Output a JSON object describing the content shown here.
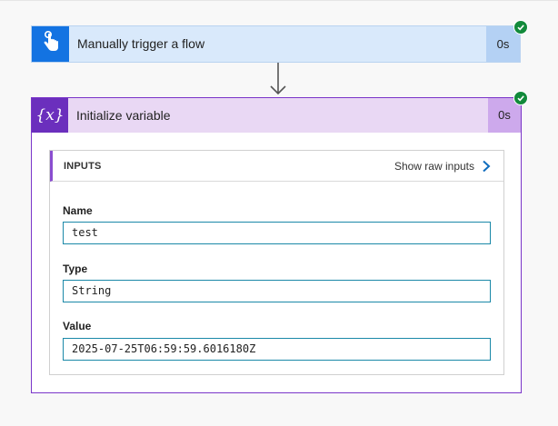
{
  "trigger": {
    "title": "Manually trigger a flow",
    "duration": "0s",
    "icon": "hand-tap-icon",
    "status": "succeeded",
    "colors": {
      "accent": "#1373e2",
      "header_bg": "#d9e9fb",
      "duration_bg": "#b4d1f4"
    }
  },
  "connector": {
    "icon": "arrow-down-icon"
  },
  "variable_action": {
    "title": "Initialize variable",
    "duration": "0s",
    "icon_text": "{x}",
    "status": "succeeded",
    "colors": {
      "accent": "#6b2fbd",
      "header_bg": "#e9d8f4",
      "duration_bg": "#cda9ec",
      "border": "#7a35c9"
    },
    "inputs": {
      "heading": "INPUTS",
      "raw_link_label": "Show raw inputs",
      "fields": [
        {
          "label": "Name",
          "value": "test"
        },
        {
          "label": "Type",
          "value": "String"
        },
        {
          "label": "Value",
          "value": "2025-07-25T06:59:59.6016180Z"
        }
      ]
    }
  },
  "status_color": "#128a3b"
}
